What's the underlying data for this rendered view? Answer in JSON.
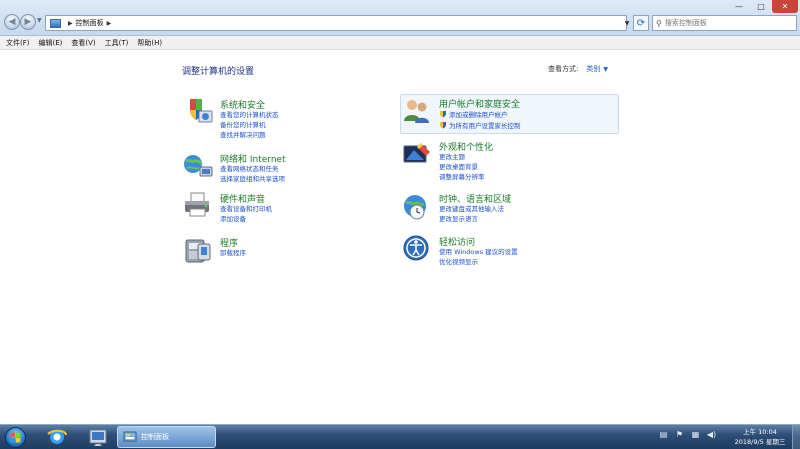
{
  "window": {
    "breadcrumb": [
      "控制面板"
    ],
    "search_placeholder": "搜索控制面板",
    "controls": {
      "minimize": "—",
      "maximize": "□",
      "close": "✕"
    }
  },
  "menu": [
    "文件(F)",
    "编辑(E)",
    "查看(V)",
    "工具(T)",
    "帮助(H)"
  ],
  "main": {
    "title": "调整计算机的设置",
    "view_by_label": "查看方式:",
    "view_by_value": "类别"
  },
  "categories": [
    {
      "title": "系统和安全",
      "icon": "shield-pc-icon",
      "links": [
        {
          "text": "查看您的计算机状态",
          "shield": false
        },
        {
          "text": "备份您的计算机",
          "shield": false
        },
        {
          "text": "查找并解决问题",
          "shield": false
        }
      ]
    },
    {
      "title": "网络和 Internet",
      "icon": "network-globe-icon",
      "links": [
        {
          "text": "查看网络状态和任务",
          "shield": false
        },
        {
          "text": "选择家庭组和共享选项",
          "shield": false
        }
      ]
    },
    {
      "title": "硬件和声音",
      "icon": "printer-icon",
      "links": [
        {
          "text": "查看设备和打印机",
          "shield": false
        },
        {
          "text": "添加设备",
          "shield": false
        }
      ]
    },
    {
      "title": "程序",
      "icon": "programs-icon",
      "links": [
        {
          "text": "卸载程序",
          "shield": false
        }
      ]
    },
    {
      "title": "用户帐户和家庭安全",
      "icon": "users-icon",
      "links": [
        {
          "text": "添加或删除用户帐户",
          "shield": true
        },
        {
          "text": "为所有用户设置家长控制",
          "shield": true
        }
      ]
    },
    {
      "title": "外观和个性化",
      "icon": "appearance-icon",
      "links": [
        {
          "text": "更改主题",
          "shield": false
        },
        {
          "text": "更改桌面背景",
          "shield": false
        },
        {
          "text": "调整屏幕分辨率",
          "shield": false
        }
      ]
    },
    {
      "title": "时钟、语言和区域",
      "icon": "clock-globe-icon",
      "links": [
        {
          "text": "更改键盘或其他输入法",
          "shield": false
        },
        {
          "text": "更改显示语言",
          "shield": false
        }
      ]
    },
    {
      "title": "轻松访问",
      "icon": "ease-of-access-icon",
      "links": [
        {
          "text": "使用 Windows 建议的设置",
          "shield": false
        },
        {
          "text": "优化视频显示",
          "shield": false
        }
      ]
    }
  ],
  "taskbar": {
    "active_window_label": "控制面板",
    "clock_time": "上午 10:04",
    "clock_date": "2018/9/5 星期三"
  },
  "colors": {
    "link": "#1c4fd0",
    "category_title": "#1b7a2a",
    "page_title": "#1e3287"
  }
}
